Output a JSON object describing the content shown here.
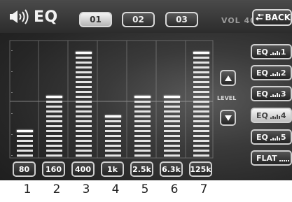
{
  "header": {
    "title": "EQ",
    "preset_tabs": [
      {
        "label": "01",
        "active": true
      },
      {
        "label": "02",
        "active": false
      },
      {
        "label": "03",
        "active": false
      }
    ],
    "volume": "VOL 40",
    "back_label": "BACK"
  },
  "bands": [
    {
      "freq": "80",
      "level": 6,
      "number": "1"
    },
    {
      "freq": "160",
      "level": 13,
      "number": "2"
    },
    {
      "freq": "400",
      "level": 22,
      "number": "3"
    },
    {
      "freq": "1k",
      "level": 9,
      "number": "4"
    },
    {
      "freq": "2.5k",
      "level": 13,
      "number": "5"
    },
    {
      "freq": "6.3k",
      "level": 13,
      "number": "6"
    },
    {
      "freq": "125k",
      "level": 22,
      "number": "7"
    }
  ],
  "level_control": {
    "label": "LEVEL"
  },
  "eq_presets": [
    {
      "label": "EQ",
      "num": "1",
      "active": false
    },
    {
      "label": "EQ",
      "num": "2",
      "active": false
    },
    {
      "label": "EQ",
      "num": "3",
      "active": false
    },
    {
      "label": "EQ",
      "num": "4",
      "active": true
    },
    {
      "label": "EQ",
      "num": "5",
      "active": false
    },
    {
      "label": "FLAT",
      "num": "",
      "active": false
    }
  ],
  "colors": {
    "accent": "#ffffff",
    "background": "#2b2b2b",
    "active_tab": "#e6e6e6"
  },
  "icons": {
    "speaker": "speaker-icon",
    "back": "back-arrow-icon",
    "up": "up-triangle-icon",
    "down": "down-triangle-icon"
  }
}
